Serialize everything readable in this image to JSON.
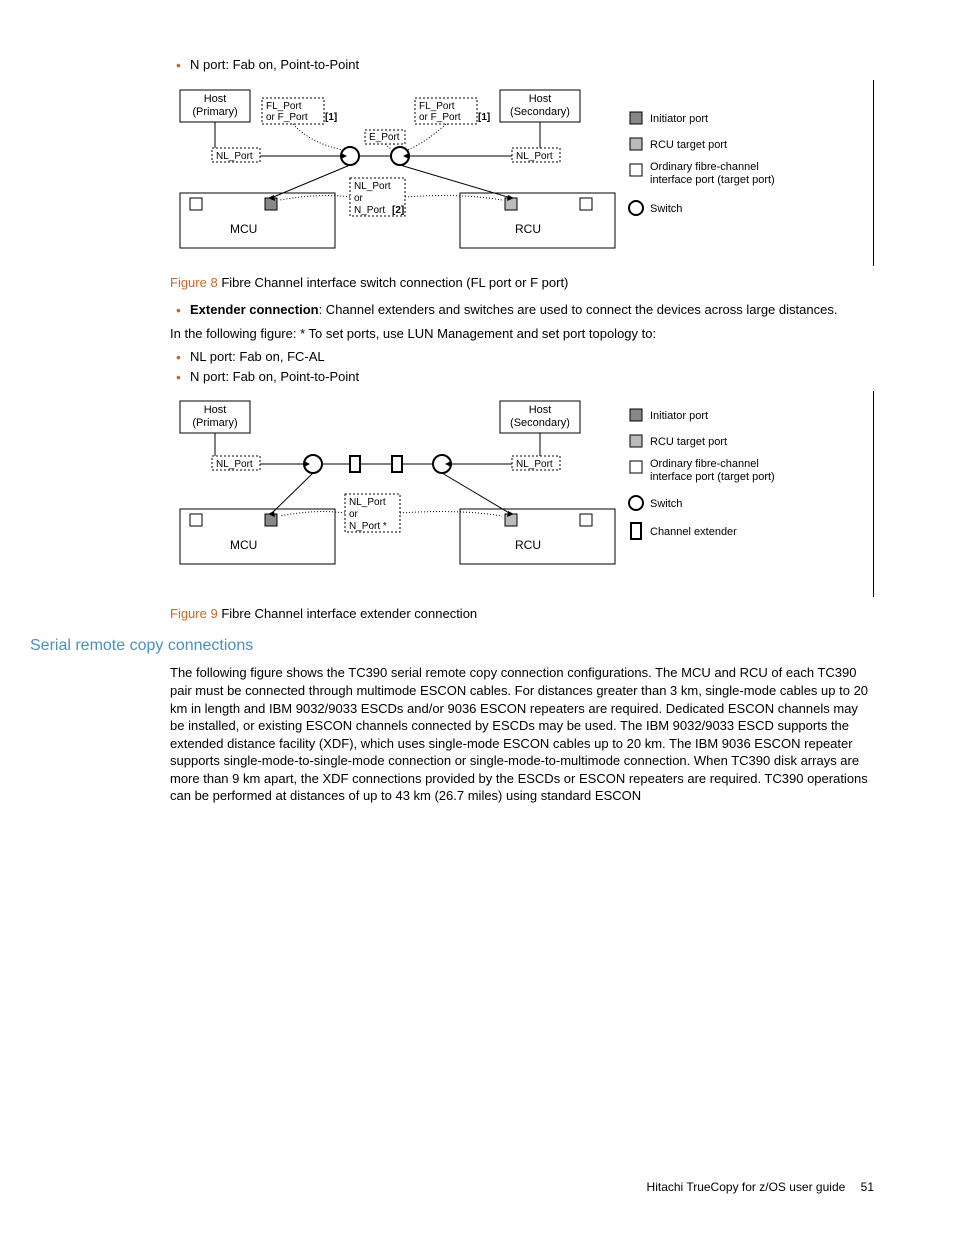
{
  "bullets1": [
    "N port: Fab on, Point-to-Point"
  ],
  "fig8_label": "Figure 8",
  "fig8_caption": "Fibre Channel interface switch connection (FL port or F port)",
  "bullets2_lead": "Extender connection",
  "bullets2_text": ": Channel extenders and switches are used to connect the devices across large distances.",
  "para1": "In the following figure: * To set ports, use LUN Management and set port topology to:",
  "bullets3": [
    "NL port: Fab on, FC-AL",
    "N port: Fab on, Point-to-Point"
  ],
  "fig9_label": "Figure 9",
  "fig9_caption": "Fibre Channel interface extender connection",
  "h2": "Serial remote copy connections",
  "para2": "The following figure shows the TC390 serial remote copy connection configurations. The MCU and RCU of each TC390 pair must be connected through multimode ESCON cables. For distances greater than 3 km, single-mode cables up to 20 km in length and IBM 9032/9033 ESCDs and/or 9036 ESCON repeaters are required. Dedicated ESCON channels may be installed, or existing ESCON channels connected by ESCDs may be used. The IBM 9032/9033 ESCD supports the extended distance facility (XDF), which uses single-mode ESCON cables up to 20 km. The IBM 9036 ESCON repeater supports single-mode-to-single-mode connection or single-mode-to-multimode connection. When TC390 disk arrays are more than 9 km apart, the XDF connections provided by the ESCDs or ESCON repeaters are required. TC390 operations can be performed at distances of up to 43 km (26.7 miles) using standard ESCON",
  "footer_text": "Hitachi TrueCopy for z/OS user guide",
  "page_number": "51",
  "diag": {
    "host_primary": "Host\n(Primary)",
    "host_secondary": "Host\n(Secondary)",
    "fl_port": "FL_Port\nor F_Port",
    "bracket1": "[1]",
    "e_port": "E_Port",
    "nl_port": "NL_Port",
    "nl_or_n": "NL_Port\nor\nN_Port",
    "bracket2": "[2]",
    "star": "*",
    "mcu": "MCU",
    "rcu": "RCU",
    "legend_initiator": "Initiator port",
    "legend_rcu": "RCU target port",
    "legend_ord": "Ordinary fibre-channel interface port (target port)",
    "legend_switch": "Switch",
    "legend_ext": "Channel extender"
  }
}
